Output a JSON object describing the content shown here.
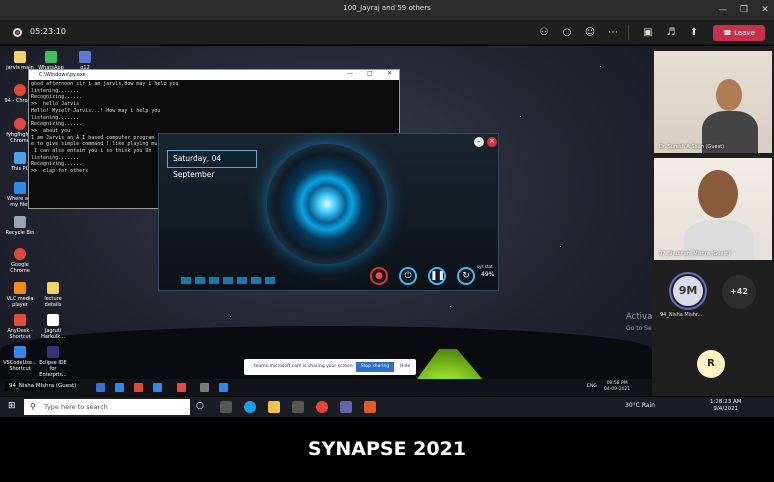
{
  "window": {
    "title": "100_Jayraj and 59 others"
  },
  "meeting": {
    "timer": "05:23:10",
    "leave_label": "Leave",
    "icons": [
      "participants-icon",
      "chat-icon",
      "reactions-icon",
      "more-icon",
      "camera-off-icon",
      "mic-off-icon",
      "share-icon"
    ]
  },
  "desktop": {
    "icons": [
      {
        "label": "jarvis main"
      },
      {
        "label": "WhatsApp"
      },
      {
        "label": "g12"
      },
      {
        "label": "94 - Chrome"
      },
      {
        "label": "fyhgfhgfg - Chrome"
      },
      {
        "label": "This PC"
      },
      {
        "label": "Where are my files"
      },
      {
        "label": "Recycle Bin"
      },
      {
        "label": "Google Chrome"
      },
      {
        "label": "VLC media player"
      },
      {
        "label": "lecture details"
      },
      {
        "label": "AnyDesk - Shortcut"
      },
      {
        "label": "Jagruti Harkulk..."
      },
      {
        "label": "VSCodeUse... Shortcut"
      },
      {
        "label": "Eclipse IDE for Enterpris..."
      }
    ],
    "console": {
      "title": "C:\\Windows\\py.exe",
      "lines": [
        "good afternoon sir i am jarvis,How may i help you",
        "listening.......",
        "Recognizing......",
        ">>  hello Jarvis",
        "Hello! Myself Jarvis...! How may i help you",
        "listening.......",
        "Recognizing......",
        ">>  about you",
        "I am Jarvis an A I based computer program",
        "e to give simple command ! like playing mu",
        " I can also entain you i so think you Un",
        "listening.......",
        "Recognizing......",
        ">>  clap for others"
      ]
    },
    "jarvis": {
      "date": "Saturday, 04 September",
      "stat_label": "sys stat",
      "stat_value": "49%"
    },
    "share_bar": {
      "text": "teams.microsoft.com is sharing your screen.",
      "stop_label": "Stop sharing",
      "hide_label": "Hide"
    },
    "activate": {
      "line1": "Activate Windows",
      "line2": "Go to Settings to activate Windows."
    },
    "remote_taskbar": {
      "name_tag": "94_Nisha Mishra (Guest)",
      "lang": "ENG",
      "time": "09:58 PM",
      "date": "04-09-2021"
    }
  },
  "participants": [
    {
      "name": "Dr. Suresh A Shan (Guest)"
    },
    {
      "name": "97_Shubham Mishra (Guest)"
    }
  ],
  "avatars": {
    "main": {
      "initials": "9M",
      "name": "94_Nisha Mishr..."
    },
    "more": "+42",
    "extra": "R"
  },
  "local_taskbar": {
    "search_placeholder": "Type here to search",
    "weather": "30°C  Rain",
    "time": "1:28:23 AM",
    "date": "9/4/2021"
  },
  "caption": "SYNAPSE 2021"
}
